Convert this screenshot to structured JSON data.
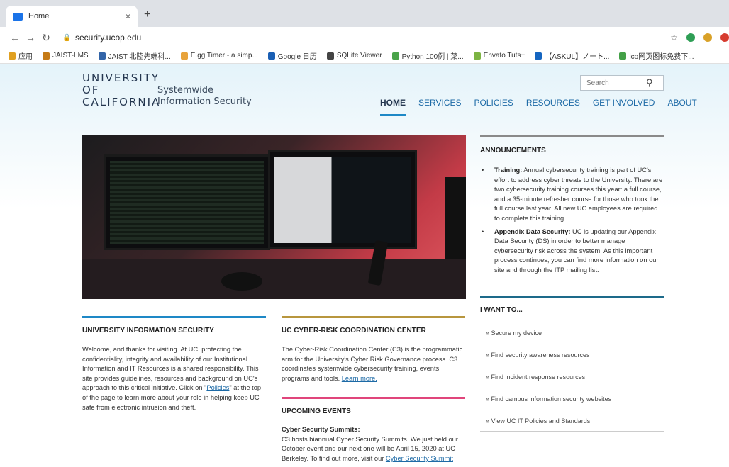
{
  "browser": {
    "tab_title": "Home",
    "tab_close": "×",
    "new_tab": "+",
    "url": "security.ucop.edu",
    "bookmarks": [
      "应用",
      "JAIST-LMS",
      "JAIST 北陸先端科...",
      "E.gg Timer - a simp...",
      "Google 日历",
      "SQLite Viewer",
      "Python 100例 | 菜...",
      "Envato Tuts+",
      "【ASKUL】ノート...",
      "ico网页图标免费下..."
    ]
  },
  "header": {
    "logo_line1": "UNIVERSITY",
    "logo_line2": "OF",
    "logo_line3": "CALIFORNIA",
    "sub_line1": "Systemwide",
    "sub_line2": "Information Security",
    "search_placeholder": "Search"
  },
  "nav": {
    "items": [
      "HOME",
      "SERVICES",
      "POLICIES",
      "RESOURCES",
      "GET INVOLVED",
      "ABOUT"
    ]
  },
  "announcements": {
    "title": "ANNOUNCEMENTS",
    "items": [
      {
        "label": "Training:",
        "text": " Annual cybersecurity training is part of UC's effort to address cyber threats to the University. There are two cybersecurity training courses this year: a full course, and a 35-minute refresher course for those who took the full course last year. All new UC employees are required to complete this training."
      },
      {
        "label": "Appendix Data Security:",
        "text": " UC is updating our Appendix Data Security (DS) in order to better manage cybersecurity risk across the system. As this important process continues, you can find more information on our site and through the ITP mailing list."
      }
    ]
  },
  "i_want_to": {
    "title": "I WANT TO...",
    "items": [
      "» Secure my device",
      "» Find security awareness resources",
      "» Find incident response resources",
      "» Find campus information security websites",
      "» View UC IT Policies and Standards"
    ]
  },
  "uis": {
    "title": "UNIVERSITY INFORMATION SECURITY",
    "text_before": "Welcome, and thanks for visiting. At UC, protecting the confidentiality, integrity and availability of our Institutional Information and IT Resources is a shared responsibility. This site provides guidelines, resources and background on UC's approach to this critical initiative. Click on \"",
    "link": "Policies",
    "text_after": "\" at the top of the page to learn more about your role in helping keep UC safe from electronic intrusion and theft."
  },
  "c3": {
    "title": "UC CYBER-RISK COORDINATION CENTER",
    "text": "The Cyber-Risk Coordination Center (C3) is the programmatic arm for the University's Cyber Risk Governance process. C3 coordinates systemwide cybersecurity training, events, programs and tools. ",
    "link": "Learn more."
  },
  "events": {
    "title": "UPCOMING EVENTS",
    "subtitle": "Cyber Security Summits:",
    "text": "C3 hosts biannual Cyber Security Summits. We just held our October event and our next one will be April 15, 2020 at UC Berkeley. To find out more, visit our ",
    "link": "Cyber Security Summit"
  },
  "colors": {
    "uis_bar": "#1e88c6",
    "c3_bar": "#b8963e",
    "events_bar": "#e0457b",
    "want_bar": "#1d6a8a",
    "ann_bar": "#8a8a8a"
  }
}
